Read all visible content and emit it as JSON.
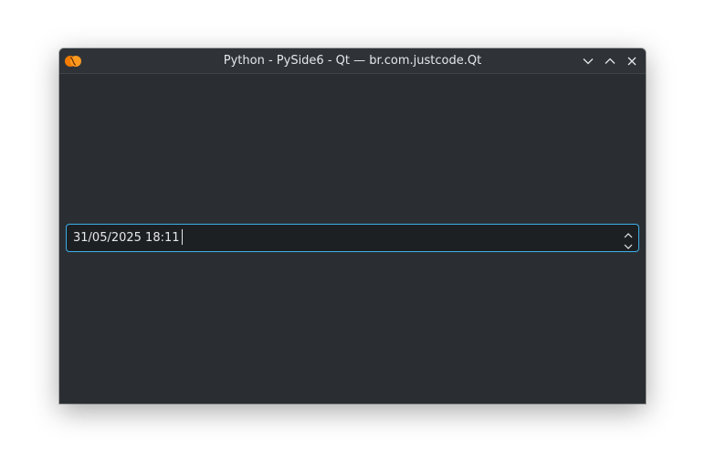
{
  "window": {
    "title": "Python - PySide6 - Qt — br.com.justcode.Qt",
    "app_icon": "python-logo-icon",
    "buttons": {
      "minimize": "chevron-down-icon",
      "maximize": "chevron-up-icon",
      "close": "close-icon"
    }
  },
  "datetime_edit": {
    "value": "31/05/2025 18:11",
    "focused": true,
    "up_icon": "spin-up-arrow-icon",
    "down_icon": "spin-down-arrow-icon"
  },
  "colors": {
    "window_bg": "#2a2e32",
    "titlebar_bg": "#2f3338",
    "input_bg": "#1d2023",
    "focus_border": "#3daee9",
    "text": "#e6e7e8",
    "app_icon": "#f57c00"
  }
}
